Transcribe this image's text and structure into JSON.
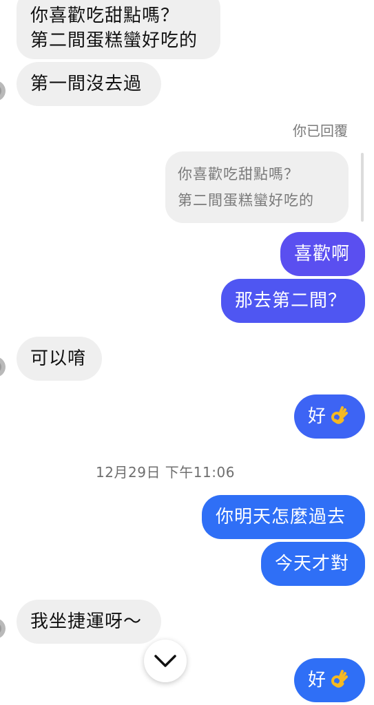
{
  "colors": {
    "incoming_bubble": "#efefef",
    "outgoing_purple": "#5a4ff0",
    "outgoing_indigo": "#4f56f2",
    "outgoing_blue": "#3d64f4",
    "outgoing_bright_blue": "#2f6ff6"
  },
  "messages": {
    "m1_line1": "你喜歡吃甜點嗎？",
    "m1_line2": "第二間蛋糕蠻好吃的",
    "m2": "第一間沒去過",
    "reply_label": "你已回覆",
    "reply_quote_line1": "你喜歡吃甜點嗎？",
    "reply_quote_line2": "第二間蛋糕蠻好吃的",
    "m3": "喜歡啊",
    "m4": "那去第二間？",
    "m5": "可以唷",
    "m6": "好",
    "timestamp": "12月29日 下午11:06",
    "m7": "你明天怎麼過去",
    "m8": "今天才對",
    "m9": "我坐捷運呀～",
    "m10": "好"
  },
  "icons": {
    "ok_hand": "ok-hand-emoji",
    "scroll_down": "chevron-down-icon"
  }
}
